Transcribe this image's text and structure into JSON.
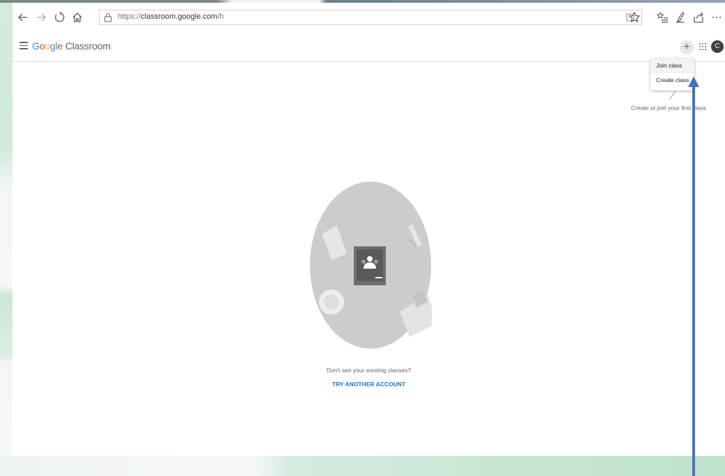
{
  "browser": {
    "address": {
      "url_prefix": "https://",
      "url_host": "classroom.google.com",
      "url_path": "/h"
    },
    "icons": [
      "back-icon",
      "forward-icon",
      "refresh-icon",
      "home-icon",
      "lock-icon",
      "reading-view-icon",
      "favorite-star-icon",
      "favorites-list-icon",
      "pen-notes-icon",
      "share-icon",
      "more-icon"
    ]
  },
  "app": {
    "logo_parts": [
      "G",
      "o",
      "o",
      "g",
      "l",
      "e"
    ],
    "logo_suffix": " Classroom",
    "avatar_initial": "C",
    "plus_label": "+"
  },
  "menu": {
    "items": [
      {
        "label": "Join class"
      },
      {
        "label": "Create class"
      }
    ]
  },
  "hint": "Create or join your first class",
  "empty_state": {
    "message": "Don't see your existing classes?",
    "link": "TRY ANOTHER ACCOUNT"
  },
  "colors": {
    "accent": "#1a73e8",
    "arrow": "#4472c4"
  }
}
